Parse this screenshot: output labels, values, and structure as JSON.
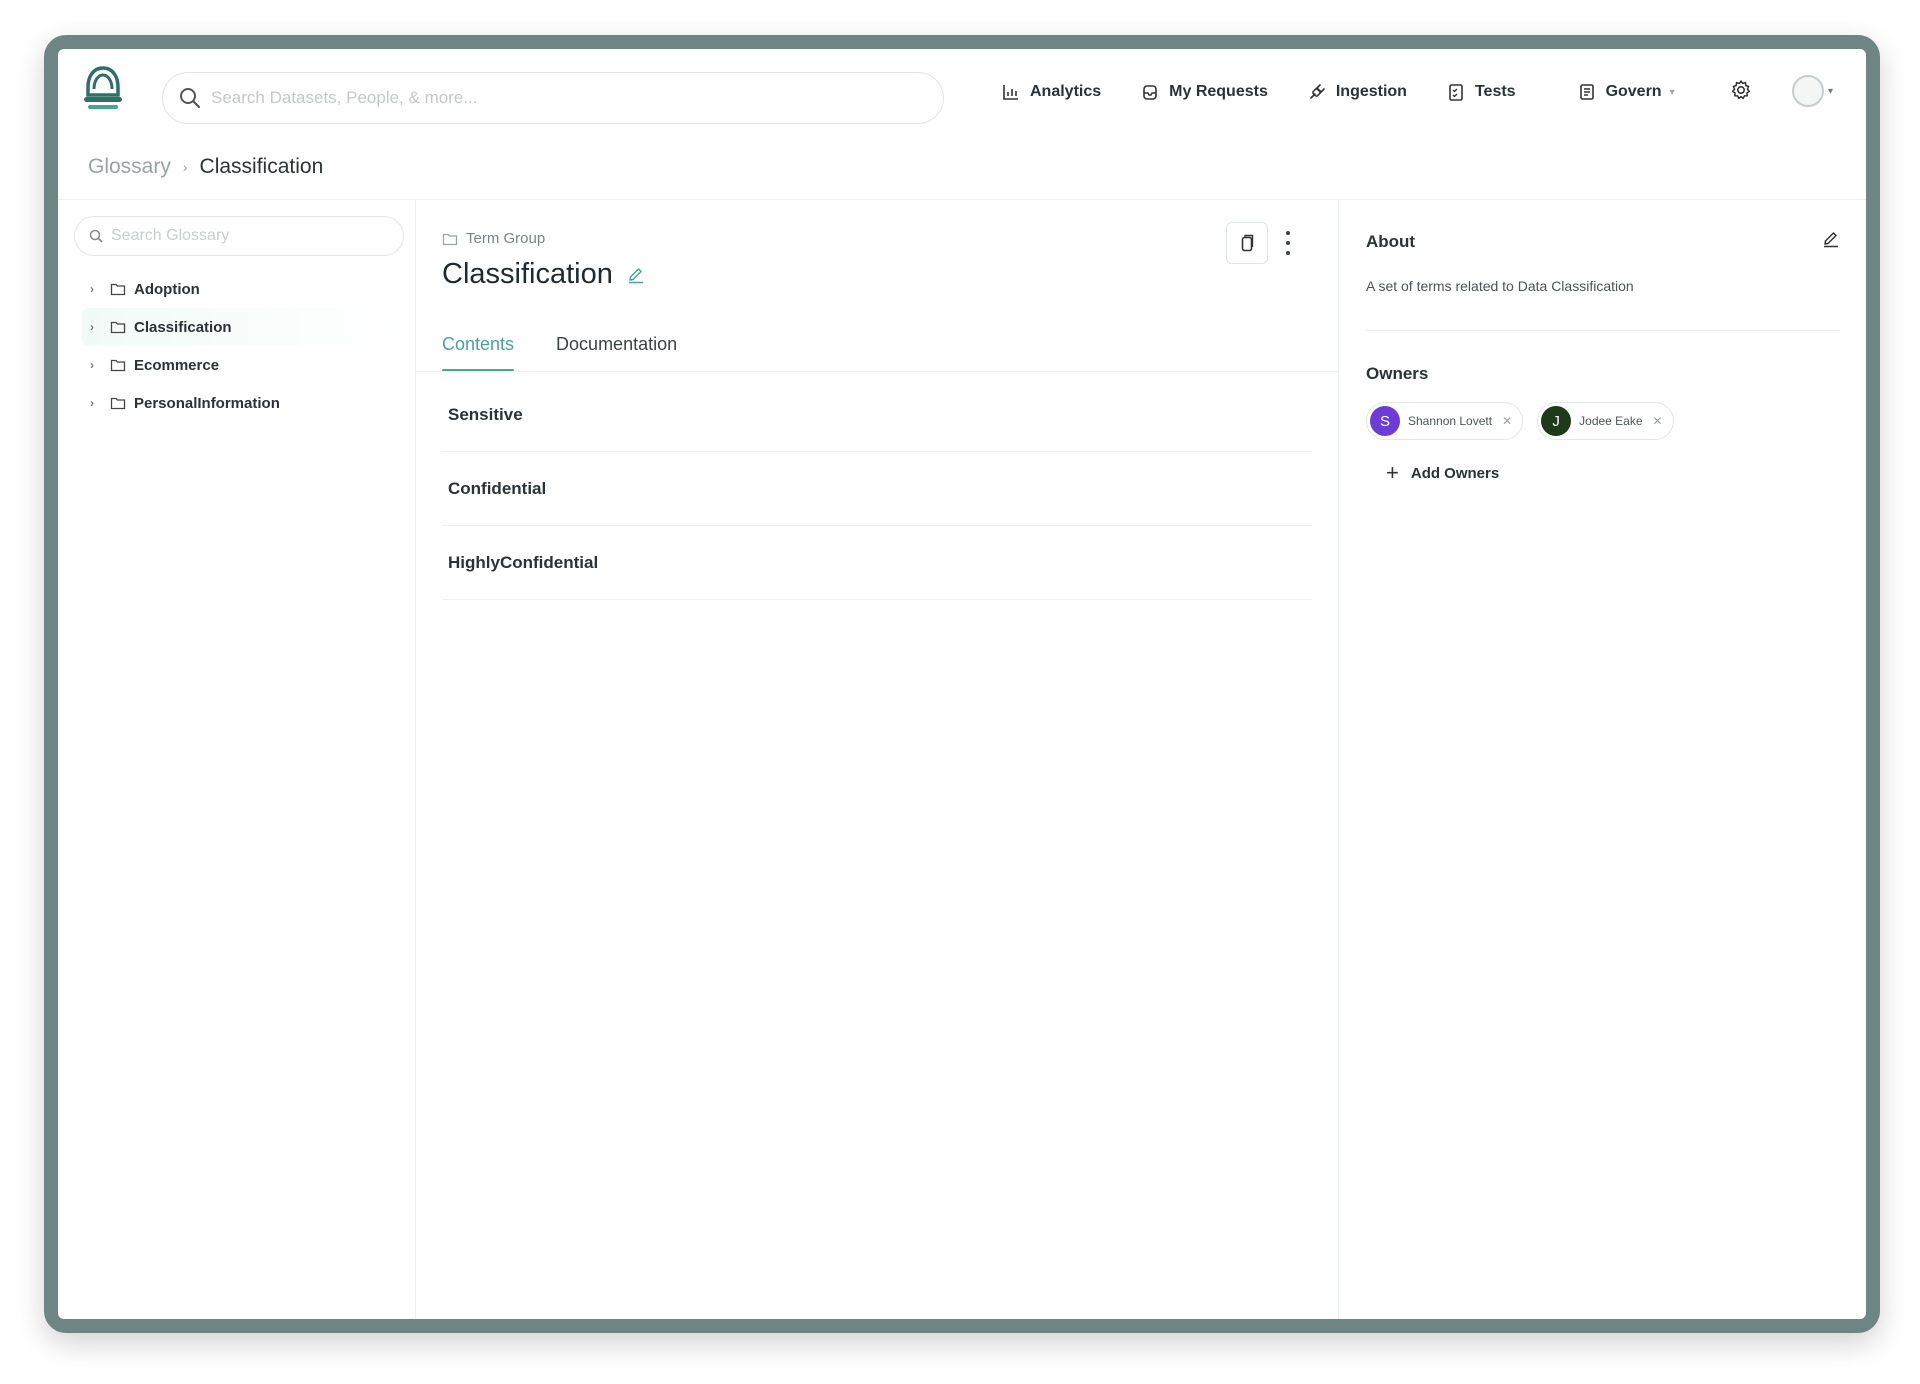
{
  "nav": {
    "search_placeholder": "Search Datasets, People, & more...",
    "items": [
      {
        "label": "Analytics",
        "icon": "bar-chart-icon"
      },
      {
        "label": "My Requests",
        "icon": "inbox-icon"
      },
      {
        "label": "Ingestion",
        "icon": "plug-icon"
      },
      {
        "label": "Tests",
        "icon": "checklist-icon"
      },
      {
        "label": "Govern",
        "icon": "book-icon"
      }
    ]
  },
  "breadcrumb": {
    "parent": "Glossary",
    "current": "Classification"
  },
  "sidebar": {
    "search_placeholder": "Search Glossary",
    "items": [
      {
        "label": "Adoption"
      },
      {
        "label": "Classification"
      },
      {
        "label": "Ecommerce"
      },
      {
        "label": "PersonalInformation"
      }
    ]
  },
  "main": {
    "kind": "Term Group",
    "title": "Classification",
    "tabs": [
      {
        "label": "Contents"
      },
      {
        "label": "Documentation"
      }
    ],
    "terms": [
      "Sensitive",
      "Confidential",
      "HighlyConfidential"
    ]
  },
  "about": {
    "heading": "About",
    "text": "A set of terms related to Data Classification"
  },
  "owners": {
    "heading": "Owners",
    "list": [
      {
        "initial": "S",
        "name": "Shannon Lovett",
        "color": "#6d3bd6"
      },
      {
        "initial": "J",
        "name": "Jodee Eake",
        "color": "#1f3a1a"
      }
    ],
    "add_label": "Add Owners"
  },
  "colors": {
    "accent": "#4aa496",
    "frame": "#6f8584"
  }
}
